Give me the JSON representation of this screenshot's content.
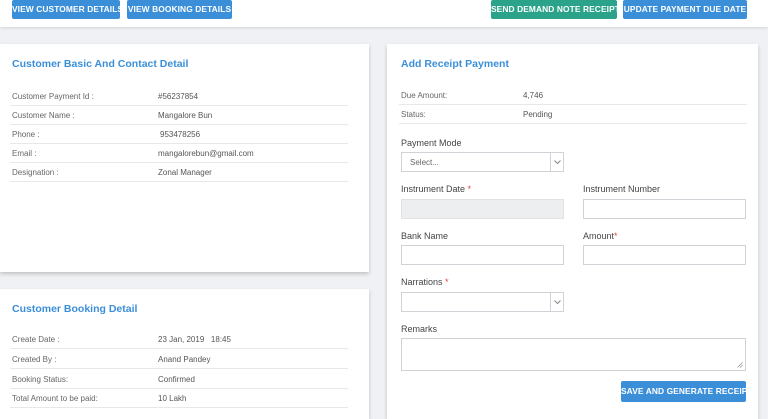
{
  "toolbar": {
    "view_customer": "VIEW CUSTOMER DETAILS",
    "view_booking": "VIEW BOOKING DETAILS",
    "send_demand": "SEND DEMAND NOTE RECEIPT",
    "update_due": "UPDATE PAYMENT DUE DATE"
  },
  "customer_card": {
    "title": "Customer Basic And Contact Detail",
    "rows": [
      {
        "label": "Customer Payment Id :",
        "value": "#56237854"
      },
      {
        "label": "Customer Name :",
        "value": "Mangalore Bun"
      },
      {
        "label": "Phone :",
        "value": "953478256"
      },
      {
        "label": "Email :",
        "value": "mangalorebun@gmail.com"
      },
      {
        "label": "Designation :",
        "value": "Zonal Manager"
      }
    ]
  },
  "booking_card": {
    "title": "Customer Booking Detail",
    "rows": [
      {
        "label": "Create Date :",
        "value": "23 Jan, 2019   18:45"
      },
      {
        "label": "Created By :",
        "value": "Anand Pandey"
      },
      {
        "label": "Booking Status:",
        "value": "Confirmed"
      },
      {
        "label": "Total Amount to be paid:",
        "value": "10 Lakh"
      }
    ]
  },
  "receipt_card": {
    "title": "Add Receipt Payment",
    "info": [
      {
        "label": "Due Amount:",
        "value": "4,746"
      },
      {
        "label": "Status:",
        "value": "Pending"
      }
    ],
    "payment_mode_label": "Payment Mode",
    "payment_mode_selected": "Select...",
    "instrument_date_label": "Instrument Date",
    "instrument_number_label": "Instrument Number",
    "bank_name_label": "Bank Name",
    "amount_label": "Amount",
    "narrations_label": "Narrations",
    "remarks_label": "Remarks",
    "required_mark": "*",
    "save_button": "SAVE AND GENERATE RECEIPT"
  },
  "colors": {
    "primary": "#3b8fd9",
    "teal": "#2aa38a",
    "required": "#e64545"
  }
}
